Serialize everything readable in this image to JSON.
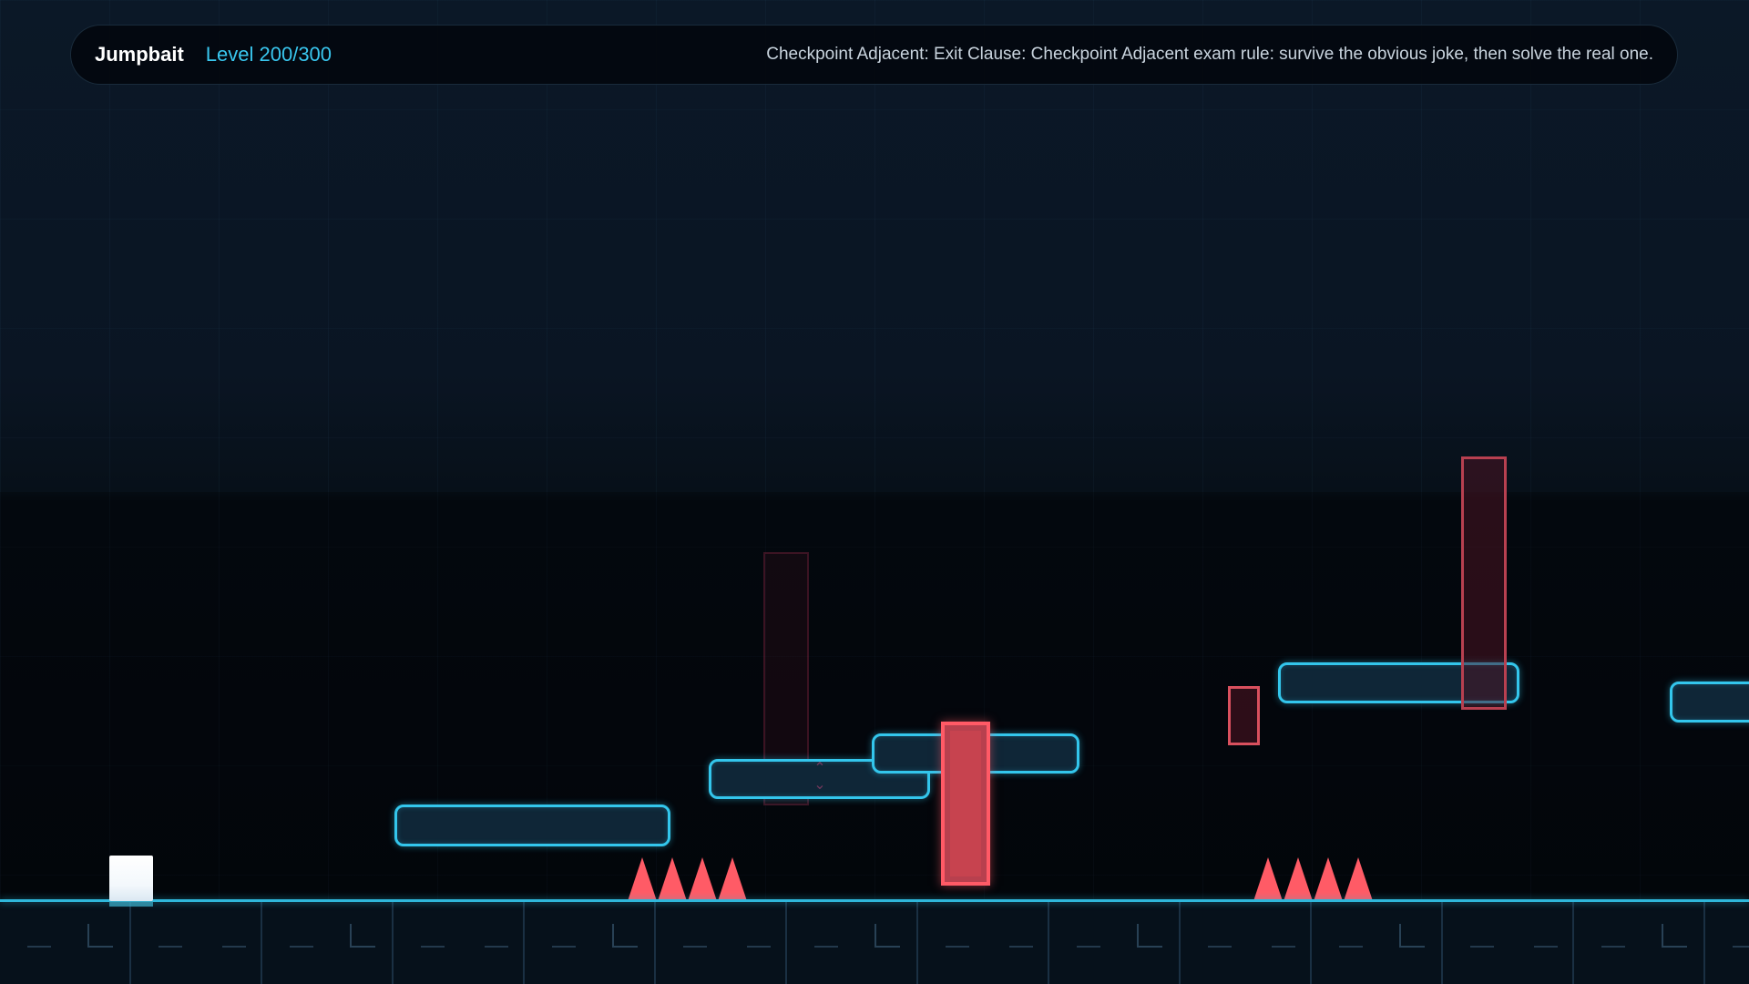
{
  "hud": {
    "title": "Jumpbait",
    "level": "Level 200/300",
    "message": "Checkpoint Adjacent: Exit Clause: Checkpoint Adjacent exam rule: survive the obvious joke, then solve the real one."
  },
  "colors": {
    "accent": "#33c6ec",
    "hazard": "#ff5b66",
    "background": "#0a1523",
    "player": "#ffffff"
  },
  "icons": {
    "platform_arrows": "up-down-chevron-icon"
  }
}
